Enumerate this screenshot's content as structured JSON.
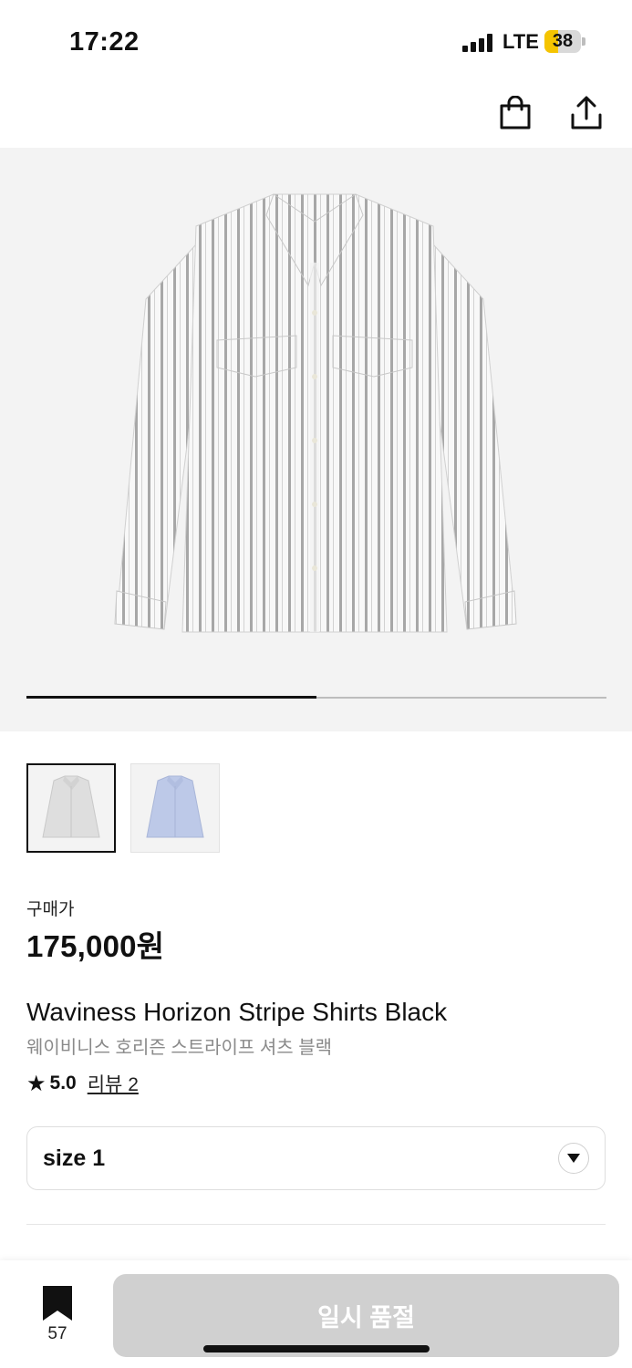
{
  "status_bar": {
    "time": "17:22",
    "network": "LTE",
    "battery": "38",
    "battery_level": 0.38
  },
  "top_nav": {
    "cart_icon": "shopping-bag-icon",
    "share_icon": "share-icon"
  },
  "gallery": {
    "image_count": 2,
    "current_index": 1,
    "progress": 0.5
  },
  "thumbnails": [
    {
      "color": "#d9d9d9",
      "selected": true
    },
    {
      "color": "#b9c6e6",
      "selected": false
    }
  ],
  "price": {
    "label": "구매가",
    "amount": "175,000원"
  },
  "product": {
    "name_en": "Waviness Horizon Stripe Shirts Black",
    "name_ko": "웨이비니스 호리즌 스트라이프 셔츠 블랙"
  },
  "rating": {
    "star": "★",
    "score": "5.0",
    "review_link": "리뷰 2"
  },
  "size_select": {
    "value": "size 1"
  },
  "bottom_bar": {
    "bookmark_count": "57",
    "sold_out_label": "일시 품절"
  }
}
